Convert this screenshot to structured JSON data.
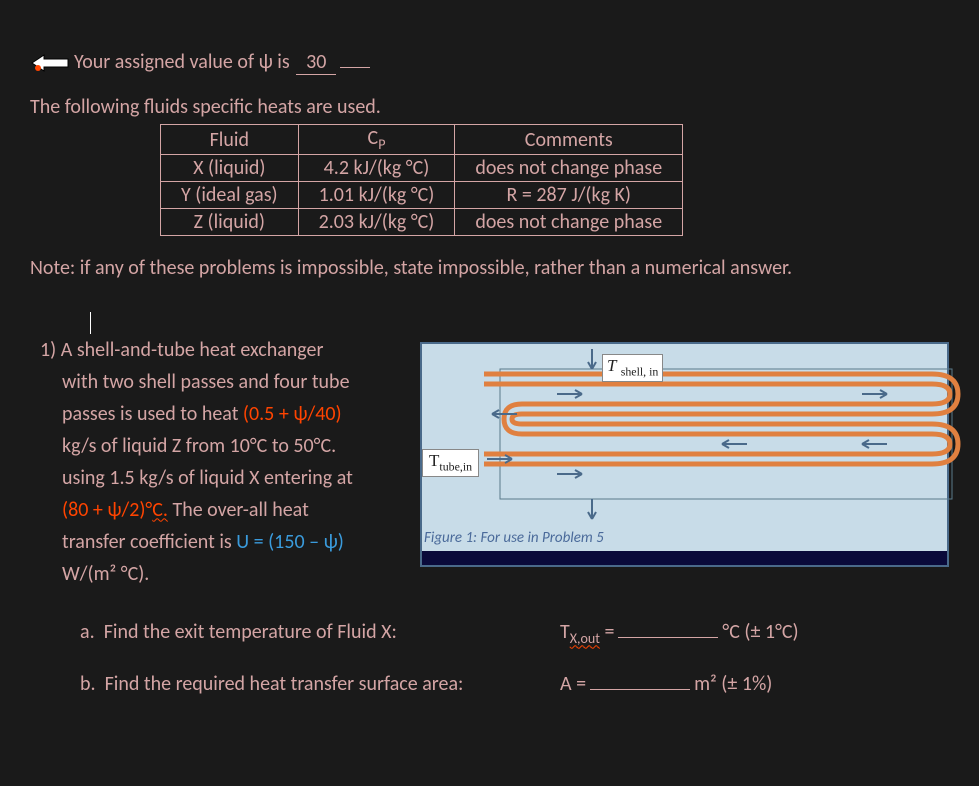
{
  "header": {
    "prefix": "Your assigned value of ψ is",
    "psi_value": "30"
  },
  "intro": "The following fluids specific heats are used.",
  "table": {
    "headers": [
      "Fluid",
      "Cₚ",
      "Comments"
    ],
    "rows": [
      [
        "X (liquid)",
        "4.2 kJ/(kg °C)",
        "does not change phase"
      ],
      [
        "Y (ideal gas)",
        "1.01 kJ/(kg °C)",
        "R = 287 J/(kg K)"
      ],
      [
        "Z (liquid)",
        "2.03 kJ/(kg °C)",
        "does not change phase"
      ]
    ]
  },
  "note": "Note: if any of these problems is impossible, state impossible, rather than a numerical answer.",
  "problem": {
    "number": "1)",
    "line1": "A shell-and-tube heat exchanger",
    "line2": "with two shell passes and four tube",
    "line3a": "passes is used to heat ",
    "line3b": "(0.5 + ψ/40)",
    "line4": "kg/s of liquid Z from 10°C to 50°C.",
    "line5": "using 1.5 kg/s of liquid X entering at",
    "line6a": "(80 + ψ/2)°",
    "line6b": "C.",
    "line6c": "  The over-all heat",
    "line7a": "transfer coefficient is ",
    "line7b": "U = (150 – ψ)",
    "line8": "W/(m² °C)."
  },
  "figure": {
    "shell_label": "T shell, in",
    "tube_label": "Ttube,in",
    "caption": "Figure 1: For use in Problem 5"
  },
  "subparts": {
    "a": {
      "label": "a.",
      "text": "Find the exit temperature of Fluid X:",
      "var_main": "T",
      "var_sub": "X,out",
      "equals": " =",
      "unit": "°C (± 1°C)"
    },
    "b": {
      "label": "b.",
      "text": "Find the required heat transfer surface area:",
      "var": "A =",
      "unit": "m² (± 1%)"
    }
  }
}
